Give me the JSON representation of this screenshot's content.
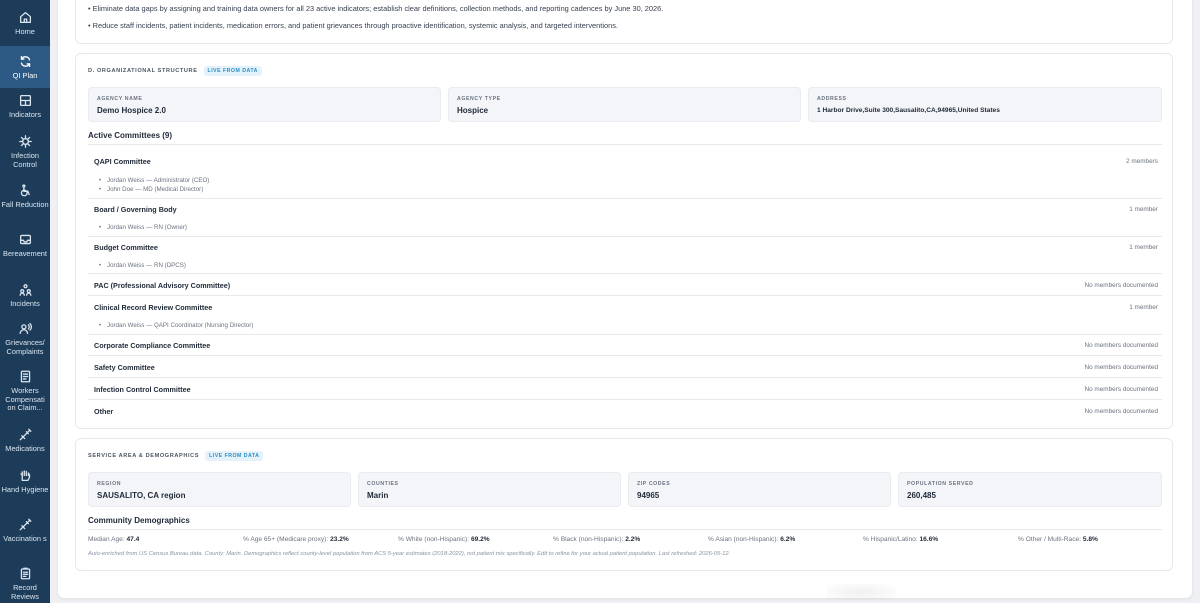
{
  "sidebar": {
    "items": [
      {
        "label": "Home",
        "icon": "home-icon"
      },
      {
        "label": "QI Plan",
        "icon": "refresh-icon"
      },
      {
        "label": "Indicators",
        "icon": "chart-icon"
      },
      {
        "label": "Infection Control",
        "icon": "virus-icon"
      },
      {
        "label": "Fall Reduction",
        "icon": "wheelchair-icon"
      },
      {
        "label": "Bereavement",
        "icon": "inbox-icon"
      },
      {
        "label": "Incidents",
        "icon": "people-icon"
      },
      {
        "label": "Grievances/ Complaints",
        "icon": "speaking-icon"
      },
      {
        "label": "Workers Compensati on Claim...",
        "icon": "document-icon"
      },
      {
        "label": "Medications",
        "icon": "syringe-icon"
      },
      {
        "label": "Hand Hygiene",
        "icon": "hand-icon"
      },
      {
        "label": "Vaccination s",
        "icon": "syringe-icon"
      },
      {
        "label": "Record Reviews",
        "icon": "clipboard-icon"
      }
    ]
  },
  "goals": {
    "line1": "• Eliminate data gaps by assigning and training data owners for all 23 active indicators; establish clear definitions, collection methods, and reporting cadences by June 30, 2026.",
    "line2": "• Reduce staff incidents, patient incidents, medication errors, and patient grievances through proactive identification, systemic analysis, and targeted interventions."
  },
  "org_structure": {
    "title": "D. ORGANIZATIONAL STRUCTURE",
    "badge": "LIVE FROM DATA",
    "agency_name_label": "AGENCY NAME",
    "agency_name": "Demo Hospice 2.0",
    "agency_type_label": "AGENCY TYPE",
    "agency_type": "Hospice",
    "address_label": "ADDRESS",
    "address": "1 Harbor Drive,Suite 300,Sausalito,CA,94965,United States",
    "committees_heading": "Active Committees (9)",
    "committees": [
      {
        "name": "QAPI Committee",
        "count": "2 members",
        "members": [
          "Jordan Weiss — Administrator (CEO)",
          "John Doe — MD (Medical Director)"
        ]
      },
      {
        "name": "Board / Governing Body",
        "count": "1 member",
        "members": [
          "Jordan Weiss — RN (Owner)"
        ]
      },
      {
        "name": "Budget Committee",
        "count": "1 member",
        "members": [
          "Jordan Weiss — RN (DPCS)"
        ]
      },
      {
        "name": "PAC (Professional Advisory Committee)",
        "count": "No members documented",
        "members": []
      },
      {
        "name": "Clinical Record Review Committee",
        "count": "1 member",
        "members": [
          "Jordan Weiss — QAPI Coordinator (Nursing Director)"
        ]
      },
      {
        "name": "Corporate Compliance Committee",
        "count": "No members documented",
        "members": []
      },
      {
        "name": "Safety Committee",
        "count": "No members documented",
        "members": []
      },
      {
        "name": "Infection Control Committee",
        "count": "No members documented",
        "members": []
      },
      {
        "name": "Other",
        "count": "No members documented",
        "members": []
      }
    ]
  },
  "service_area": {
    "title": "SERVICE AREA & DEMOGRAPHICS",
    "badge": "LIVE FROM DATA",
    "region_label": "REGION",
    "region": "SAUSALITO, CA region",
    "counties_label": "COUNTIES",
    "counties": "Marin",
    "zip_label": "ZIP CODES",
    "zip": "94965",
    "population_label": "POPULATION SERVED",
    "population": "260,485",
    "demographics_heading": "Community Demographics",
    "demographics": [
      {
        "label": "Median Age:",
        "value": "47.4"
      },
      {
        "label": "% Age 65+ (Medicare proxy):",
        "value": "23.2%"
      },
      {
        "label": "% White (non-Hispanic):",
        "value": "69.2%"
      },
      {
        "label": "% Black (non-Hispanic):",
        "value": "2.2%"
      },
      {
        "label": "% Asian (non-Hispanic):",
        "value": "6.2%"
      },
      {
        "label": "% Hispanic/Latino:",
        "value": "16.6%"
      },
      {
        "label": "% Other / Multi-Race:",
        "value": "5.8%"
      }
    ],
    "footnote": "Auto-enriched from US Census Bureau data. County: Marin. Demographics reflect county-level population from ACS 5-year estimates (2018-2022), not patient mix specifically. Edit to refine for your actual patient population. Last refreshed: 2026-05-12."
  }
}
